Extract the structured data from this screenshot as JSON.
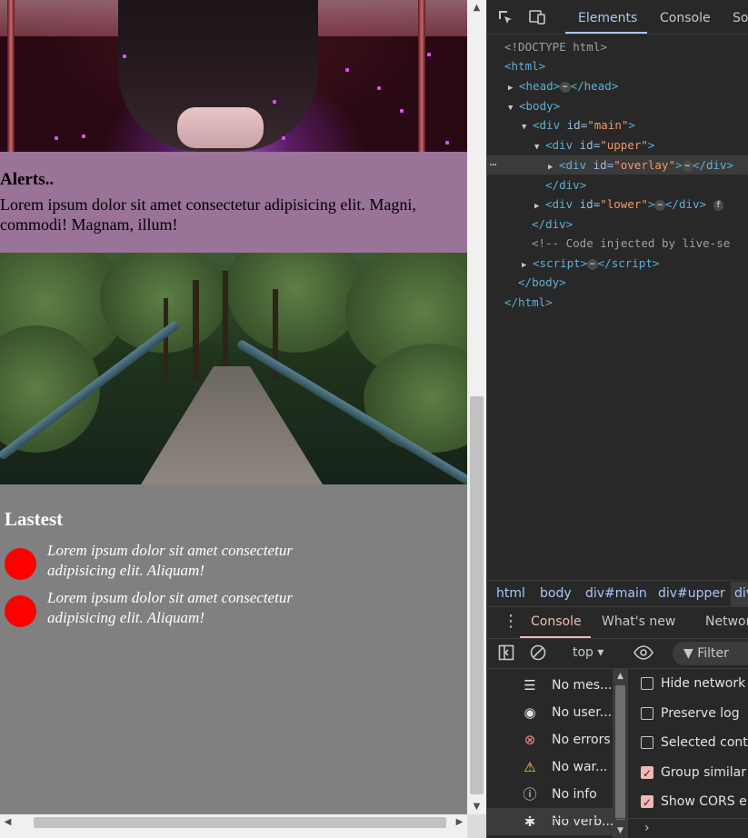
{
  "page": {
    "alerts": {
      "heading": "Alerts..",
      "text": "Lorem ipsum dolor sit amet consectetur adipisicing elit. Magni, commodi! Magnam, illum!"
    },
    "latest": {
      "heading": "Lastest",
      "items": [
        {
          "text": "Lorem ipsum dolor sit amet consectetur adipisicing elit. Aliquam!"
        },
        {
          "text": "Lorem ipsum dolor sit amet consectetur adipisicing elit. Aliquam!"
        }
      ]
    }
  },
  "devtools": {
    "tabs": {
      "elements": "Elements",
      "console": "Console",
      "sources": "So"
    },
    "dom": {
      "doctype": "<!DOCTYPE html>",
      "html_open": "<html>",
      "head": "head",
      "body": "body",
      "div": "div",
      "script": "script",
      "id_attr": "id",
      "main_id": "\"main\"",
      "upper_id": "\"upper\"",
      "overlay_id": "\"overlay\"",
      "lower_id": "\"lower\"",
      "comment": "<!-- Code injected by live-se",
      "ellipsis": "⋯",
      "gutter_dots": "⋯",
      "flex_badge": "f"
    },
    "breadcrumbs": [
      "html",
      "body",
      "div#main",
      "div#upper",
      "div"
    ],
    "drawer_tabs": {
      "menu_glyph": "⋮",
      "console": "Console",
      "whats_new": "What's new",
      "network": "Networ"
    },
    "toolbar": {
      "context": "top ▾",
      "filter": "Filter"
    },
    "levels": [
      {
        "icon": "list-icon",
        "glyph": "☰",
        "color": "#e3e3e3",
        "text": "No mes..."
      },
      {
        "icon": "user-icon",
        "glyph": "◉",
        "color": "#e3e3e3",
        "text": "No user..."
      },
      {
        "icon": "error-icon",
        "glyph": "⊗",
        "color": "#f28b82",
        "text": "No errors"
      },
      {
        "icon": "warning-icon",
        "glyph": "⚠",
        "color": "#fdd663",
        "text": "No war..."
      },
      {
        "icon": "info-icon",
        "glyph": "ⓘ",
        "color": "#e3e3e3",
        "text": "No info"
      },
      {
        "icon": "bug-icon",
        "glyph": "✱",
        "color": "#e3e3e3",
        "text": "No verb..."
      }
    ],
    "settings": [
      {
        "label": "Hide network",
        "checked": false
      },
      {
        "label": "Preserve log",
        "checked": false
      },
      {
        "label": "Selected conte",
        "checked": false
      },
      {
        "label": "Group similar r",
        "checked": true
      },
      {
        "label": "Show CORS err",
        "checked": true
      }
    ],
    "prompt": "›",
    "accent_color": "#a8c7fa",
    "console_accent_color": "#f2b8b5"
  }
}
